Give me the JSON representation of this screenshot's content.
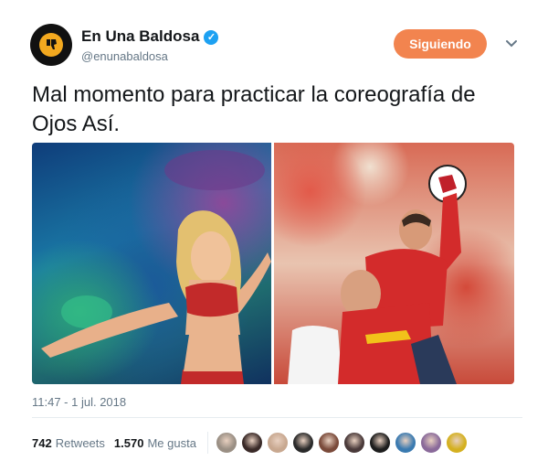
{
  "account": {
    "name": "En Una Baldosa",
    "handle": "@enunabaldosa",
    "verified": true
  },
  "follow_button": {
    "label": "Siguiendo",
    "color": "#f2844f"
  },
  "tweet": {
    "text": "Mal momento para practicar la coreografía de Ojos Así.",
    "timestamp": "11:47 - 1 jul. 2018"
  },
  "stats": {
    "retweets_count": "742",
    "retweets_label": "Retweets",
    "likes_count": "1.570",
    "likes_label": "Me gusta"
  },
  "likers": [
    {
      "color": "#9a8f84"
    },
    {
      "color": "#3a2a28"
    },
    {
      "color": "#c8a890"
    },
    {
      "color": "#2a2a2a"
    },
    {
      "color": "#7a4a3a"
    },
    {
      "color": "#4a3a3a"
    },
    {
      "color": "#1d1d1d"
    },
    {
      "color": "#3a7ab0"
    },
    {
      "color": "#8a6a9a"
    },
    {
      "color": "#d4b020"
    }
  ],
  "colors": {
    "text": "#14171a",
    "secondary": "#657786",
    "verified_badge": "#1da1f2"
  }
}
